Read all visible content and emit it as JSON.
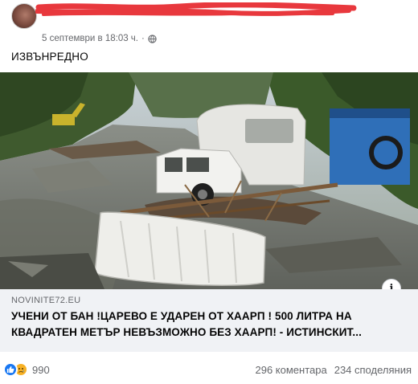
{
  "post": {
    "timestamp": "5 септември в 18:03 ч.",
    "separator": "·",
    "text": "ИЗВЪНРЕДНО"
  },
  "link": {
    "domain": "NOVINITE72.EU",
    "title": "УЧЕНИ ОТ БАН !ЦАРЕВО Е УДАРЕН ОТ ХААРП ! 500 ЛИТРА НА КВАДРАТЕН МЕТЪР НЕВЪЗМОЖНО БЕЗ ХААРП! - ИСТИНСКИТ..."
  },
  "media": {
    "info_label": "i"
  },
  "stats": {
    "reaction_count": "990",
    "comments": "296 коментара",
    "shares": "234 споделяния"
  },
  "icons": {
    "privacy": "globe-icon",
    "reactions": [
      "like-icon",
      "sad-icon"
    ]
  },
  "colors": {
    "redaction": "#e8383d",
    "link_background": "#f0f2f5",
    "like_blue": "#1877f2",
    "sad_yellow": "#f7b125",
    "meta_gray": "#65676b"
  }
}
